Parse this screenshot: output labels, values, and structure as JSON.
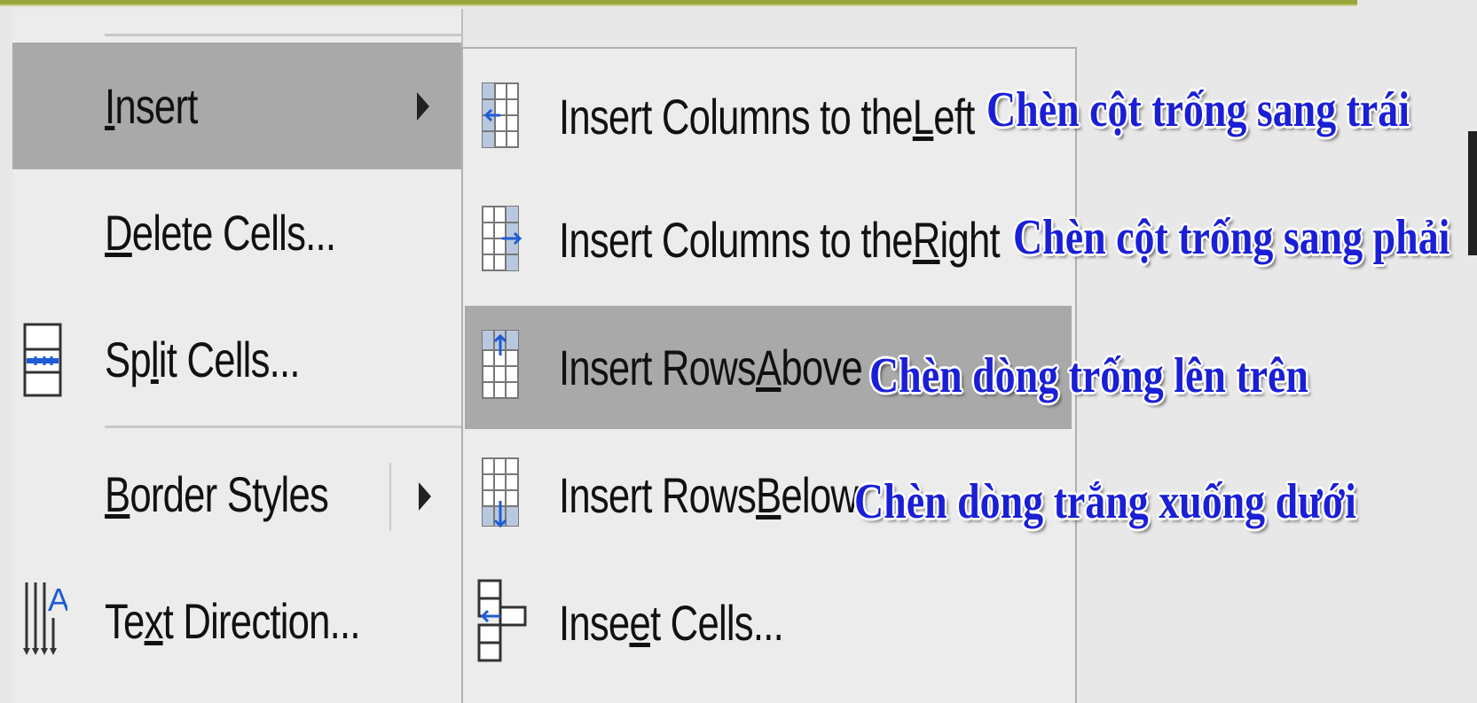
{
  "main_menu": {
    "items": [
      {
        "label": "Insert",
        "mnemonic_index": 0,
        "has_submenu": true,
        "active": true
      },
      {
        "label": "Delete Cells...",
        "mnemonic_index": 0
      },
      {
        "label": "Split Cells...",
        "mnemonic_index": 2,
        "icon": "split-cells-icon"
      },
      {
        "label": "Border Styles",
        "mnemonic_index": 0,
        "has_submenu": true
      },
      {
        "label": "Text Direction...",
        "mnemonic_index": 2,
        "icon": "text-direction-icon"
      }
    ]
  },
  "submenu": {
    "items": [
      {
        "label": "Insert Columns to the Left",
        "icon": "insert-columns-left-icon"
      },
      {
        "label": "Insert Columns to the Right",
        "icon": "insert-columns-right-icon"
      },
      {
        "label": "Insert Rows Above",
        "icon": "insert-rows-above-icon",
        "active": true
      },
      {
        "label": "Insert Rows Below",
        "icon": "insert-rows-below-icon"
      },
      {
        "label": "Insert Cells...",
        "icon": "insert-cells-icon"
      }
    ]
  },
  "annotations": [
    "Chèn cột trống sang trái",
    "Chèn cột trống sang phải",
    "Chèn dòng trống lên trên",
    "Chèn dòng trắng xuống dưới"
  ],
  "colors": {
    "accent_bar": "#9aa53a",
    "highlight": "#a9a9a9",
    "annotation_text": "#1a1fd6"
  }
}
